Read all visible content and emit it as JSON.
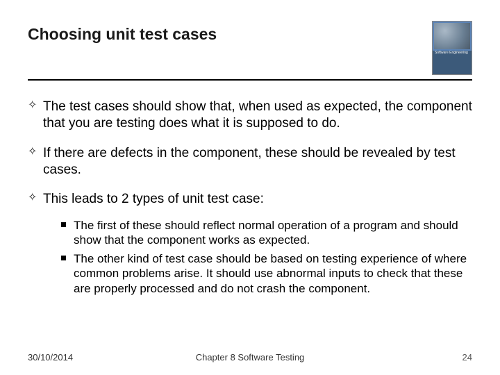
{
  "header": {
    "title": "Choosing unit test cases",
    "book_label": "Software Engineering"
  },
  "bullets": {
    "b1": "The test cases should show that, when used as expected, the component that you are testing does what it is supposed to do.",
    "b2": "If there are defects in the component, these should be revealed by test cases.",
    "b3": "This leads to 2 types of unit test case:"
  },
  "subbullets": {
    "s1": "The first of these should reflect normal operation of a program and should show that the component works as expected.",
    "s2": "The other kind of test case should be based on testing experience of where common problems arise. It should use abnormal inputs to check that these are properly processed and do not crash the component."
  },
  "footer": {
    "date": "30/10/2014",
    "chapter": "Chapter 8 Software Testing",
    "page": "24"
  }
}
